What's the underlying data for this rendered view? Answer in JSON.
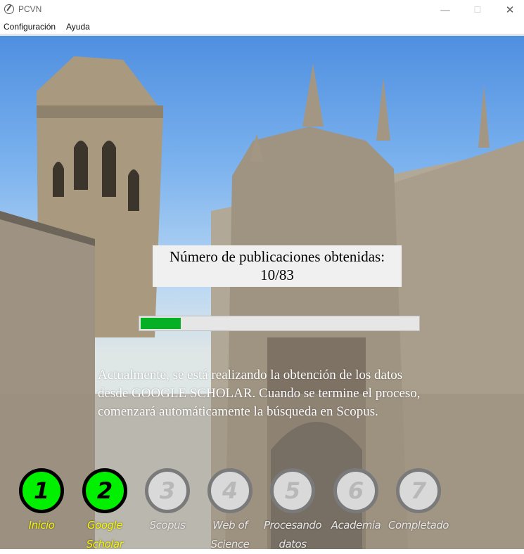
{
  "window": {
    "title": "PCVN",
    "minimize": "—",
    "maximize": "☐",
    "close": "✕"
  },
  "menu": [
    "Configuración",
    "Ayuda"
  ],
  "progress": {
    "heading": "Número de publicaciones obtenidas:",
    "count": "10/83",
    "current": 10,
    "total": 83,
    "fill_color": "#06b025"
  },
  "status_message": "Actualmente, se está realizando la obtención de los datos\ndesde GOOGLE SCHOLAR.  Cuando se termine el proceso,\ncomenzará automáticamente la búsqueda en Scopus.",
  "steps": [
    {
      "number": "1",
      "label": "Inicio",
      "state": "done"
    },
    {
      "number": "2",
      "label": "Google\nScholar",
      "state": "done"
    },
    {
      "number": "3",
      "label": "Scopus",
      "state": "todo"
    },
    {
      "number": "4",
      "label": "Web of\nScience",
      "state": "todo"
    },
    {
      "number": "5",
      "label": "Procesando\ndatos",
      "state": "todo"
    },
    {
      "number": "6",
      "label": "Academia",
      "state": "todo"
    },
    {
      "number": "7",
      "label": "Completado",
      "state": "todo"
    }
  ],
  "colors": {
    "step_done": "#00f000",
    "step_todo": "#d9d9d9",
    "label_done": "#f6f600"
  }
}
